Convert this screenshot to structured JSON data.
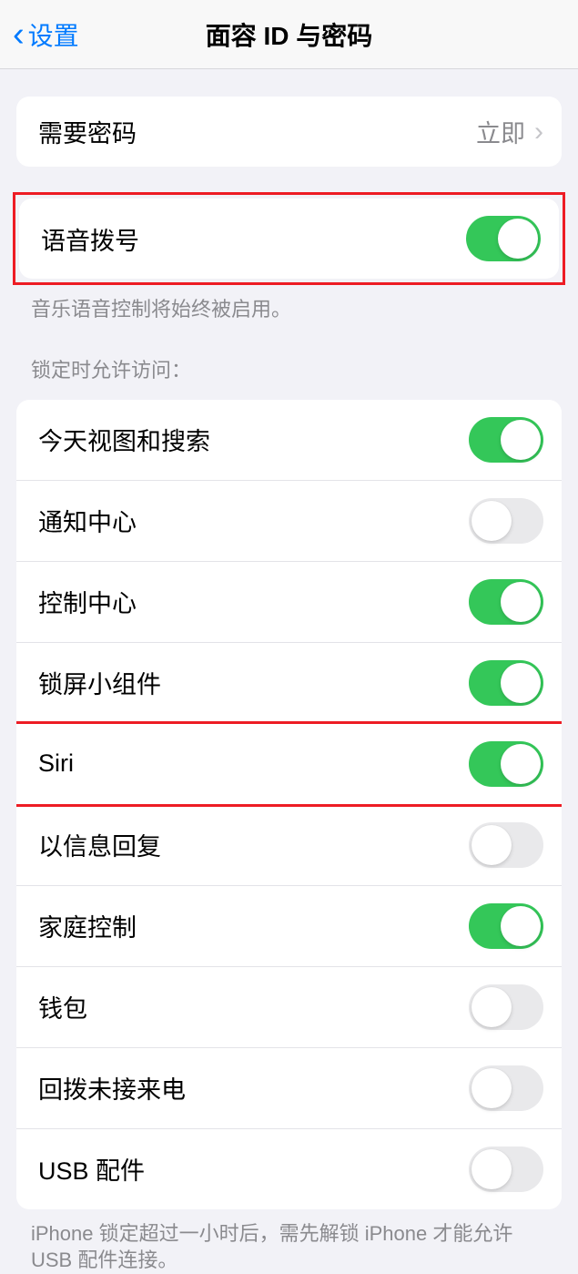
{
  "header": {
    "back_label": "设置",
    "title": "面容 ID 与密码"
  },
  "passcode_row": {
    "label": "需要密码",
    "value": "立即"
  },
  "voice_dial": {
    "label": "语音拨号",
    "on": true,
    "footer": "音乐语音控制将始终被启用。"
  },
  "lock_access": {
    "header": "锁定时允许访问：",
    "items": [
      {
        "key": "today",
        "label": "今天视图和搜索",
        "on": true
      },
      {
        "key": "notification",
        "label": "通知中心",
        "on": false
      },
      {
        "key": "control",
        "label": "控制中心",
        "on": true
      },
      {
        "key": "widgets",
        "label": "锁屏小组件",
        "on": true
      },
      {
        "key": "siri",
        "label": "Siri",
        "on": true
      },
      {
        "key": "reply",
        "label": "以信息回复",
        "on": false
      },
      {
        "key": "home",
        "label": "家庭控制",
        "on": true
      },
      {
        "key": "wallet",
        "label": "钱包",
        "on": false
      },
      {
        "key": "callback",
        "label": "回拨未接来电",
        "on": false
      },
      {
        "key": "usb",
        "label": "USB 配件",
        "on": false
      }
    ],
    "footer": "iPhone 锁定超过一小时后，需先解锁 iPhone 才能允许 USB 配件连接。"
  },
  "highlighted_keys": [
    "siri"
  ]
}
